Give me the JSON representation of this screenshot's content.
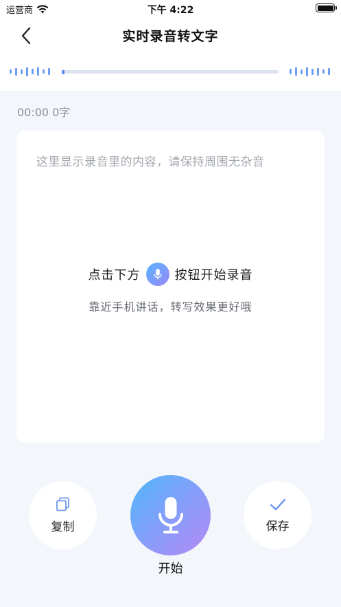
{
  "status_bar": {
    "carrier": "运营商",
    "time": "下午 4:22"
  },
  "nav": {
    "title": "实时录音转文字"
  },
  "recording": {
    "elapsed": "00:00",
    "char_count": "0字",
    "progress": 0
  },
  "content": {
    "placeholder": "这里显示录音里的内容，请保持周围无杂音",
    "hint_before": "点击下方",
    "hint_after": "按钮开始录音",
    "sub_hint": "靠近手机讲话，转写效果更好哦"
  },
  "actions": {
    "copy_label": "复制",
    "start_label": "开始",
    "save_label": "保存"
  },
  "colors": {
    "accent_start": "#4fb7fc",
    "accent_end": "#b688f3",
    "wave": "#6e9cf5"
  }
}
